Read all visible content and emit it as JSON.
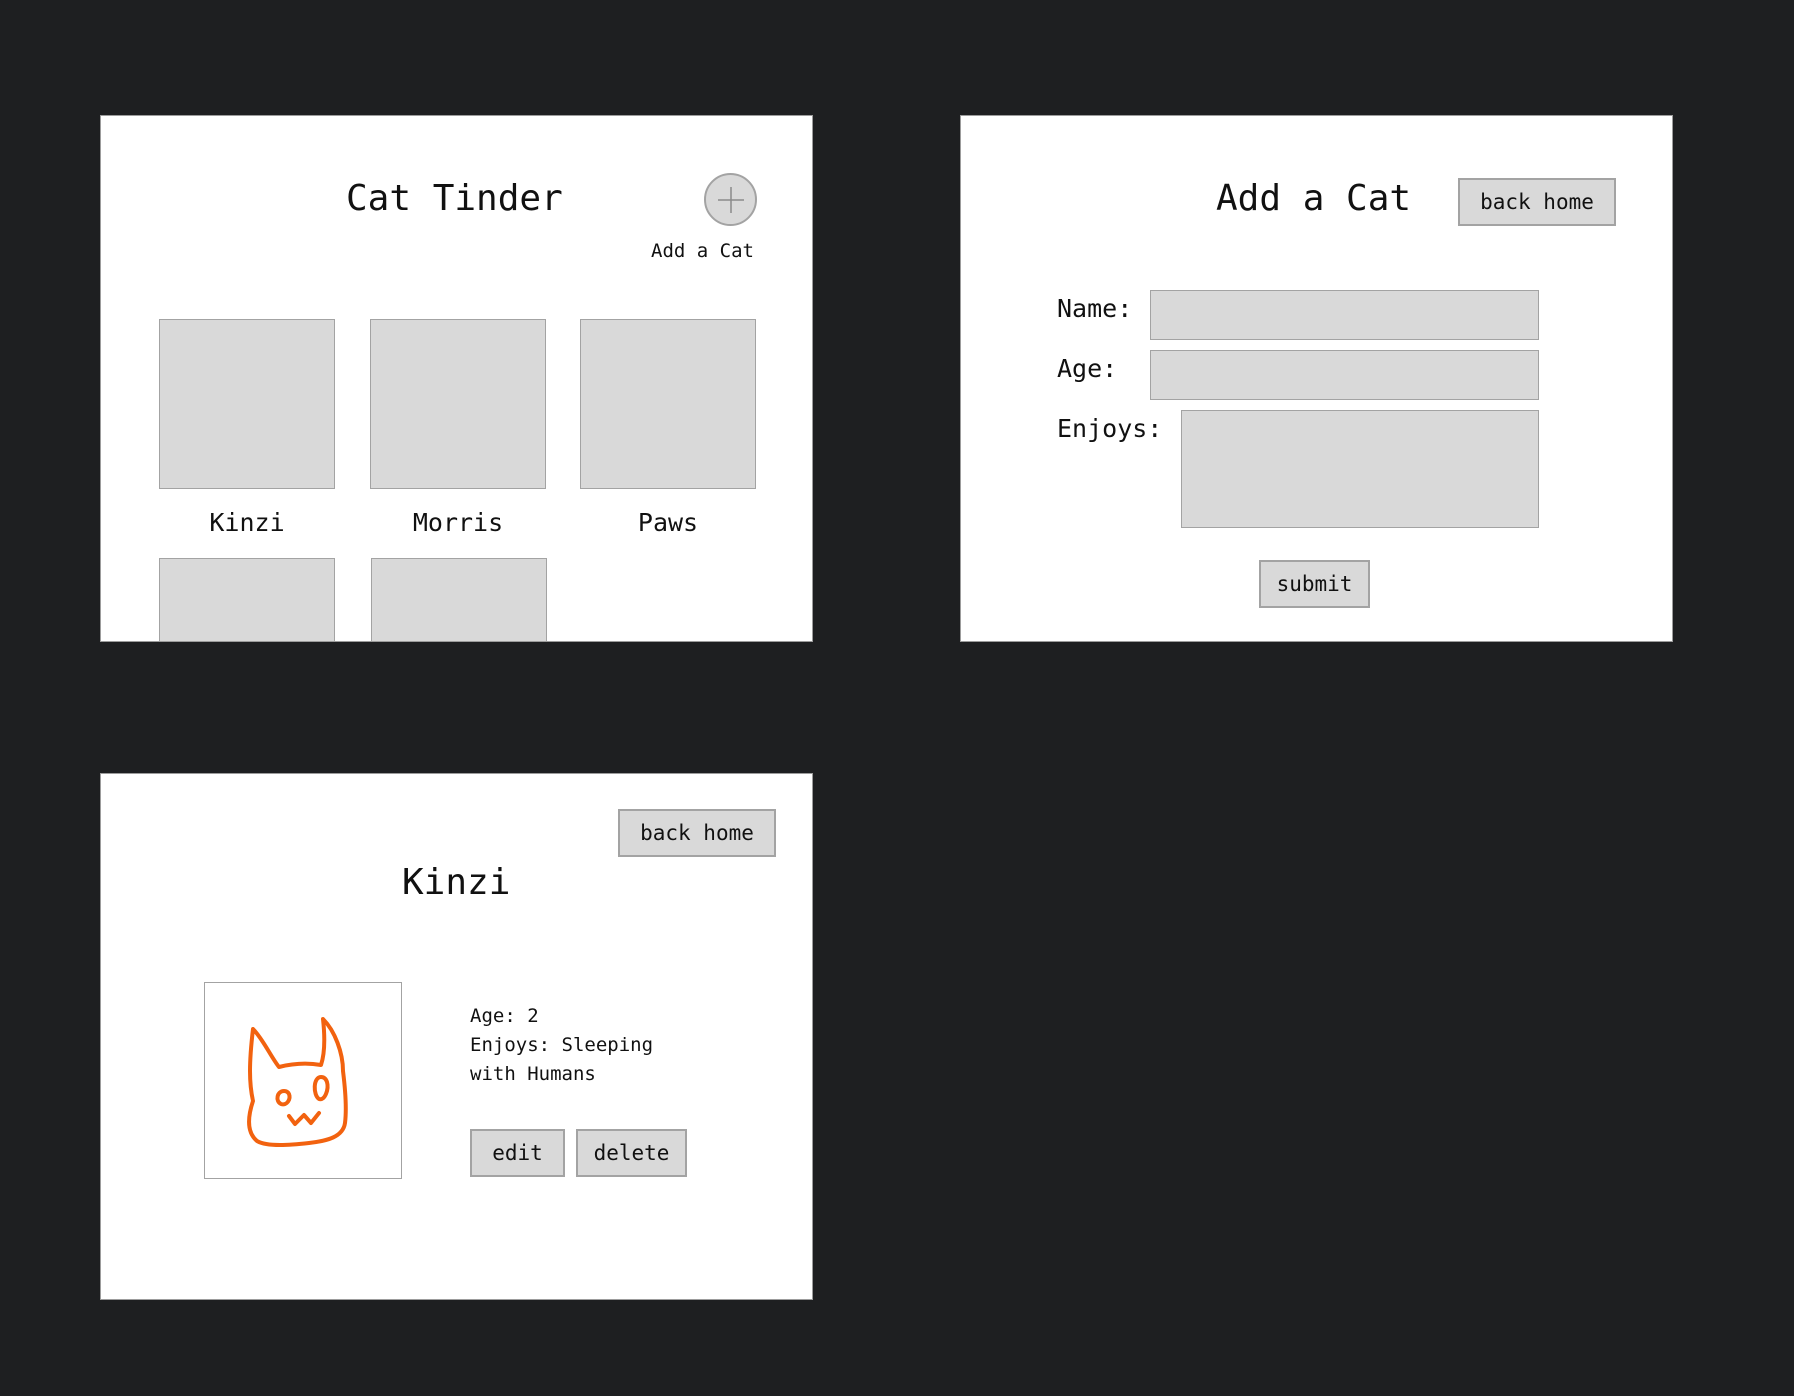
{
  "home": {
    "title": "Cat Tinder",
    "add_icon": "plus-icon",
    "add_label": "Add a Cat",
    "cats": [
      {
        "name": "Kinzi"
      },
      {
        "name": "Morris"
      },
      {
        "name": "Paws"
      },
      {
        "name": ""
      },
      {
        "name": ""
      }
    ]
  },
  "add_form": {
    "title": "Add a Cat",
    "back_label": "back home",
    "name_label": "Name:",
    "age_label": "Age:",
    "enjoys_label": "Enjoys:",
    "name_value": "",
    "age_value": "",
    "enjoys_value": "",
    "submit_label": "submit"
  },
  "detail": {
    "back_label": "back home",
    "name": "Kinzi",
    "photo_icon": "cat-face-icon",
    "age_text": "Age: 2",
    "enjoys_text": "Enjoys: Sleeping with Humans",
    "edit_label": "edit",
    "delete_label": "delete"
  },
  "colors": {
    "background": "#1e1f21",
    "panel": "#ffffff",
    "placeholder": "#d9d9d9",
    "border": "#a3a3a3",
    "cat_sketch": "#f2620f"
  }
}
